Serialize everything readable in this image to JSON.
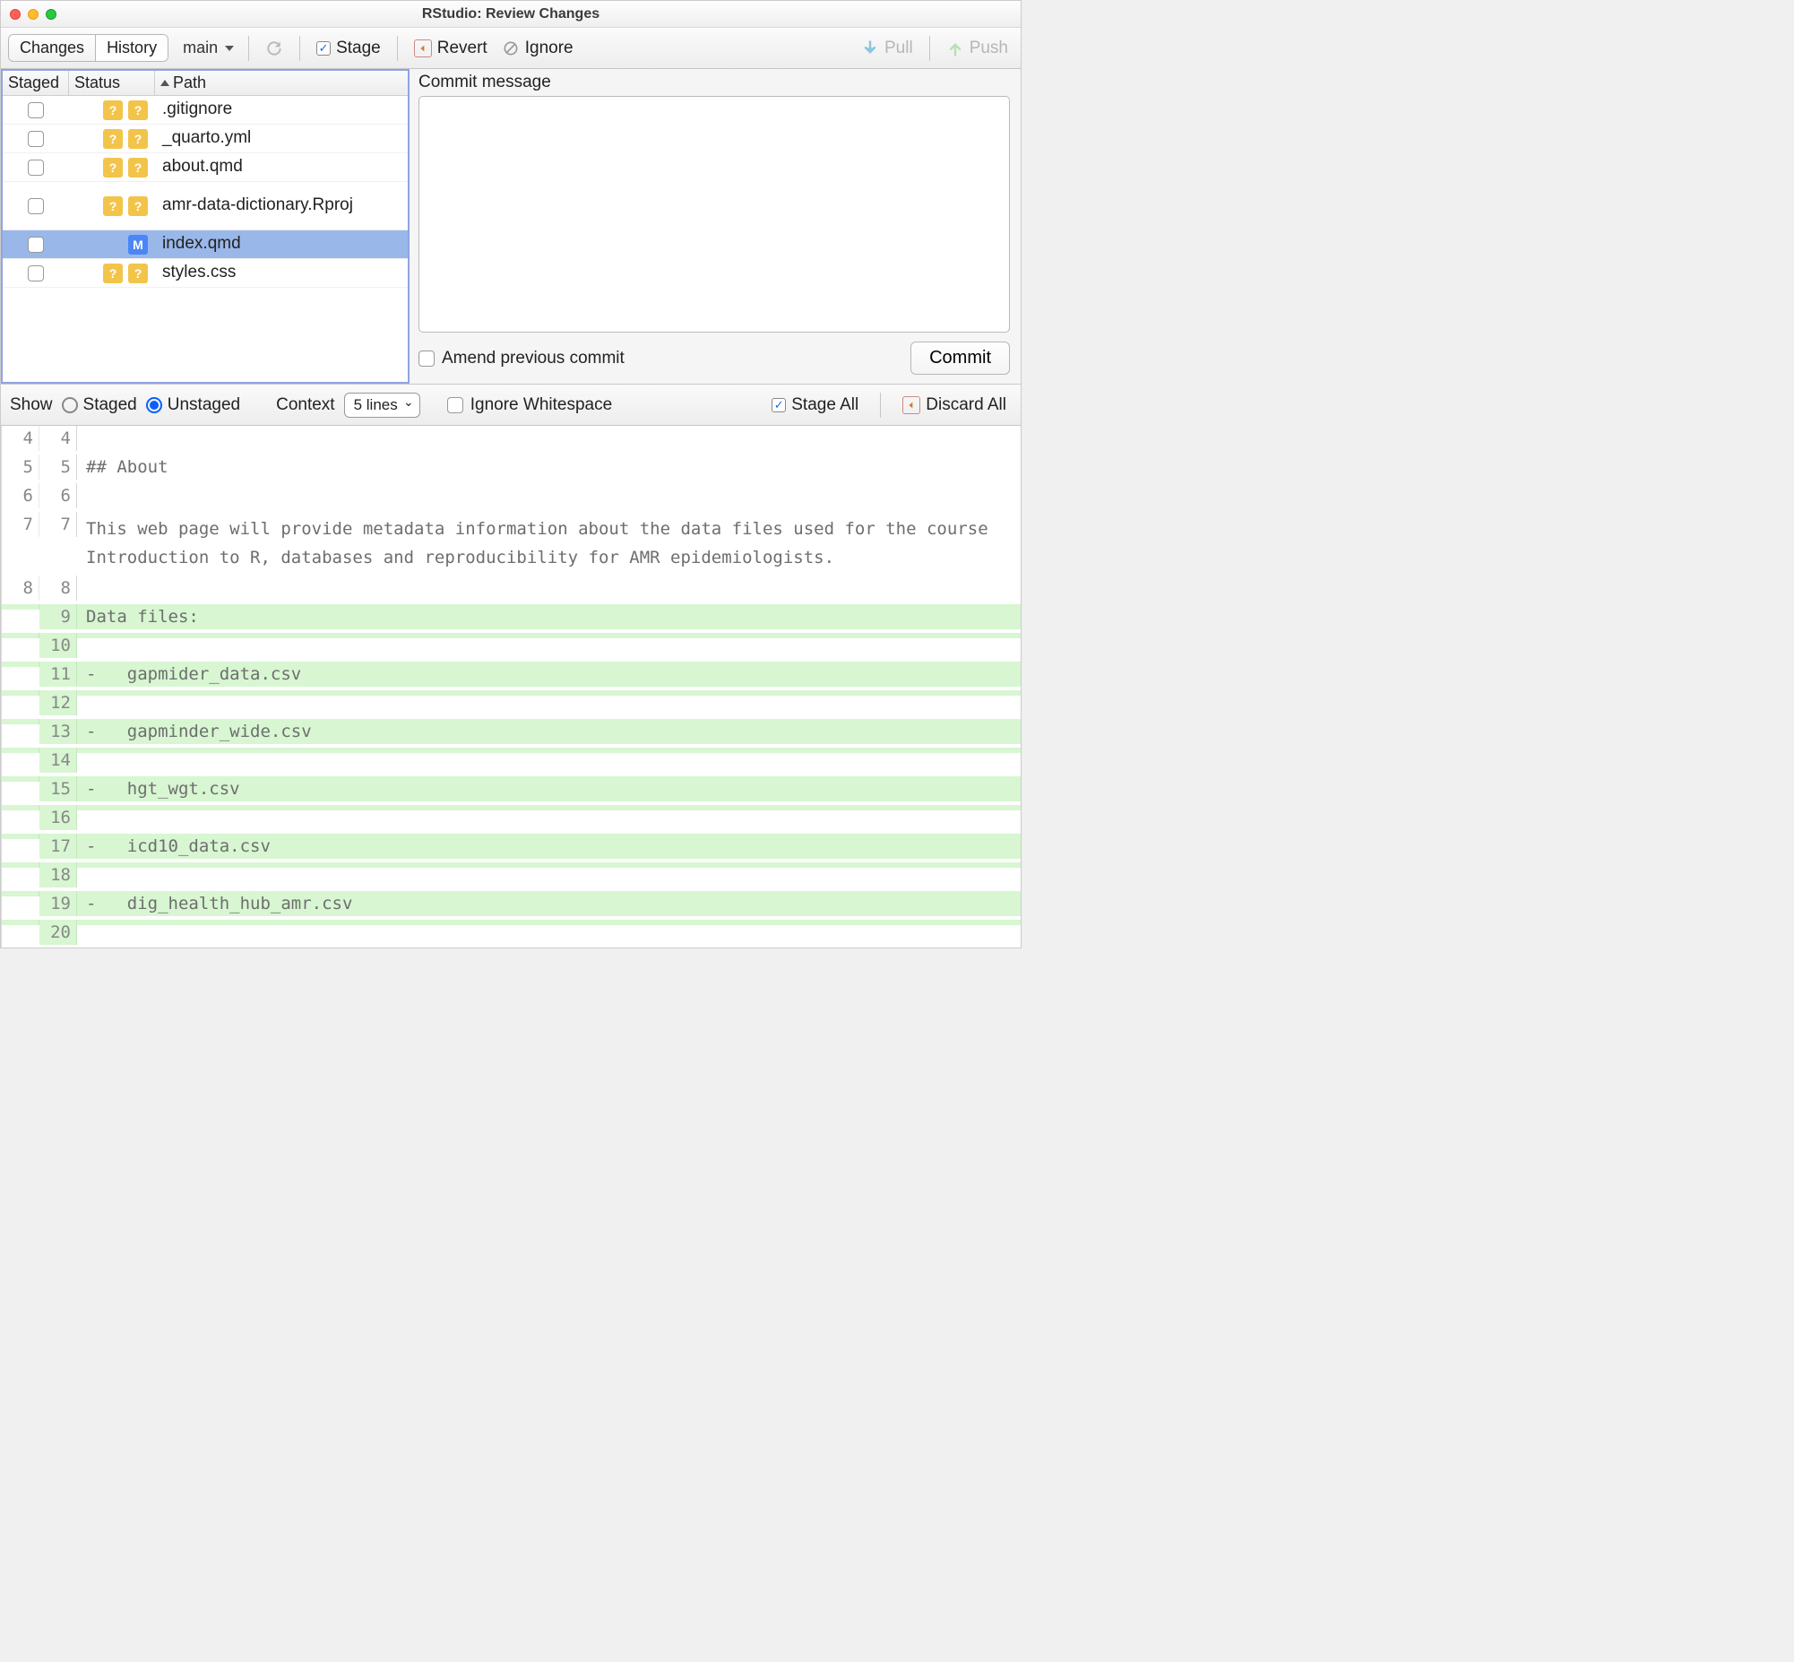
{
  "window_title": "RStudio: Review Changes",
  "toolbar": {
    "tabs": {
      "changes": "Changes",
      "history": "History"
    },
    "branch": "main",
    "stage": "Stage",
    "revert": "Revert",
    "ignore": "Ignore",
    "pull": "Pull",
    "push": "Push"
  },
  "files": {
    "header": {
      "staged": "Staged",
      "status": "Status",
      "path": "Path"
    },
    "rows": [
      {
        "status": [
          "?",
          "?"
        ],
        "path": ".gitignore"
      },
      {
        "status": [
          "?",
          "?"
        ],
        "path": "_quarto.yml"
      },
      {
        "status": [
          "?",
          "?"
        ],
        "path": "about.qmd"
      },
      {
        "status": [
          "?",
          "?"
        ],
        "path": "amr-data-dictionary.Rproj",
        "tall": true
      },
      {
        "status": [
          "",
          "M"
        ],
        "path": "index.qmd",
        "selected": true
      },
      {
        "status": [
          "?",
          "?"
        ],
        "path": "styles.css"
      }
    ]
  },
  "commit": {
    "label": "Commit message",
    "amend": "Amend previous commit",
    "button": "Commit"
  },
  "diffbar": {
    "show": "Show",
    "staged": "Staged",
    "unstaged": "Unstaged",
    "context": "Context",
    "context_val": "5 lines",
    "ignore_ws": "Ignore Whitespace",
    "stage_all": "Stage All",
    "discard_all": "Discard All"
  },
  "diff": [
    {
      "a": "4",
      "b": "4",
      "t": ""
    },
    {
      "a": "5",
      "b": "5",
      "t": "## About"
    },
    {
      "a": "6",
      "b": "6",
      "t": ""
    },
    {
      "a": "7",
      "b": "7",
      "t": "This web page will provide metadata information about the data files used for the course Introduction to R, databases and reproducibility for AMR epidemiologists.",
      "wrap": true
    },
    {
      "a": "8",
      "b": "8",
      "t": ""
    },
    {
      "a": "",
      "b": "9",
      "t": "Data files:",
      "added": true
    },
    {
      "a": "",
      "b": "10",
      "t": "",
      "added": true
    },
    {
      "a": "",
      "b": "11",
      "t": "-   gapmider_data.csv",
      "added": true
    },
    {
      "a": "",
      "b": "12",
      "t": "",
      "added": true
    },
    {
      "a": "",
      "b": "13",
      "t": "-   gapminder_wide.csv",
      "added": true
    },
    {
      "a": "",
      "b": "14",
      "t": "",
      "added": true
    },
    {
      "a": "",
      "b": "15",
      "t": "-   hgt_wgt.csv",
      "added": true
    },
    {
      "a": "",
      "b": "16",
      "t": "",
      "added": true
    },
    {
      "a": "",
      "b": "17",
      "t": "-   icd10_data.csv",
      "added": true
    },
    {
      "a": "",
      "b": "18",
      "t": "",
      "added": true
    },
    {
      "a": "",
      "b": "19",
      "t": "-   dig_health_hub_amr.csv",
      "added": true
    },
    {
      "a": "",
      "b": "20",
      "t": "",
      "added": true
    }
  ]
}
